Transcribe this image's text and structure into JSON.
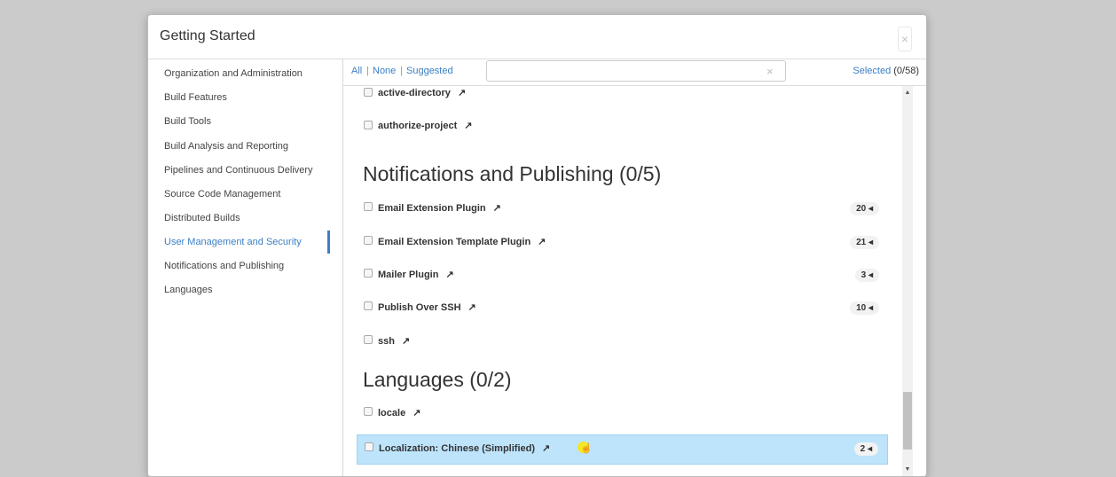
{
  "dialog": {
    "title": "Getting Started",
    "close_glyph": "×"
  },
  "sidebar": {
    "items": [
      {
        "label": "Organization and Administration"
      },
      {
        "label": "Build Features"
      },
      {
        "label": "Build Tools"
      },
      {
        "label": "Build Analysis and Reporting"
      },
      {
        "label": "Pipelines and Continuous Delivery"
      },
      {
        "label": "Source Code Management"
      },
      {
        "label": "Distributed Builds"
      },
      {
        "label": "User Management and Security",
        "active": true
      },
      {
        "label": "Notifications and Publishing"
      },
      {
        "label": "Languages"
      }
    ]
  },
  "toolbar": {
    "all_label": "All",
    "none_label": "None",
    "suggested_label": "Suggested",
    "separator": "|",
    "search": {
      "value": "",
      "placeholder": ""
    },
    "clear_glyph": "×",
    "selected_label": "Selected",
    "selected_count": "(0/58)"
  },
  "content": {
    "top_plugins": [
      {
        "name": "active-directory",
        "ext": "↗"
      },
      {
        "name": "authorize-project",
        "ext": "↗"
      }
    ],
    "notifications": {
      "title": "Notifications and Publishing (0/5)",
      "plugins": [
        {
          "name": "Email Extension Plugin",
          "ext": "↗",
          "deps": "20 ◂"
        },
        {
          "name": "Email Extension Template Plugin",
          "ext": "↗",
          "deps": "21 ◂"
        },
        {
          "name": "Mailer Plugin",
          "ext": "↗",
          "deps": "3 ◂"
        },
        {
          "name": "Publish Over SSH",
          "ext": "↗",
          "deps": "10 ◂"
        },
        {
          "name": "ssh",
          "ext": "↗"
        }
      ]
    },
    "languages": {
      "title": "Languages (0/2)",
      "plugins": [
        {
          "name": "locale",
          "ext": "↗"
        },
        {
          "name": "Localization: Chinese (Simplified)",
          "ext": "↗",
          "deps": "2 ◂",
          "highlighted": true
        }
      ]
    }
  },
  "scrollbar": {
    "up_glyph": "▲",
    "down_glyph": "▼"
  },
  "colors": {
    "accent": "#3b7fc4",
    "highlight": "#bde4fb",
    "backdrop": "#cbcbcb"
  }
}
